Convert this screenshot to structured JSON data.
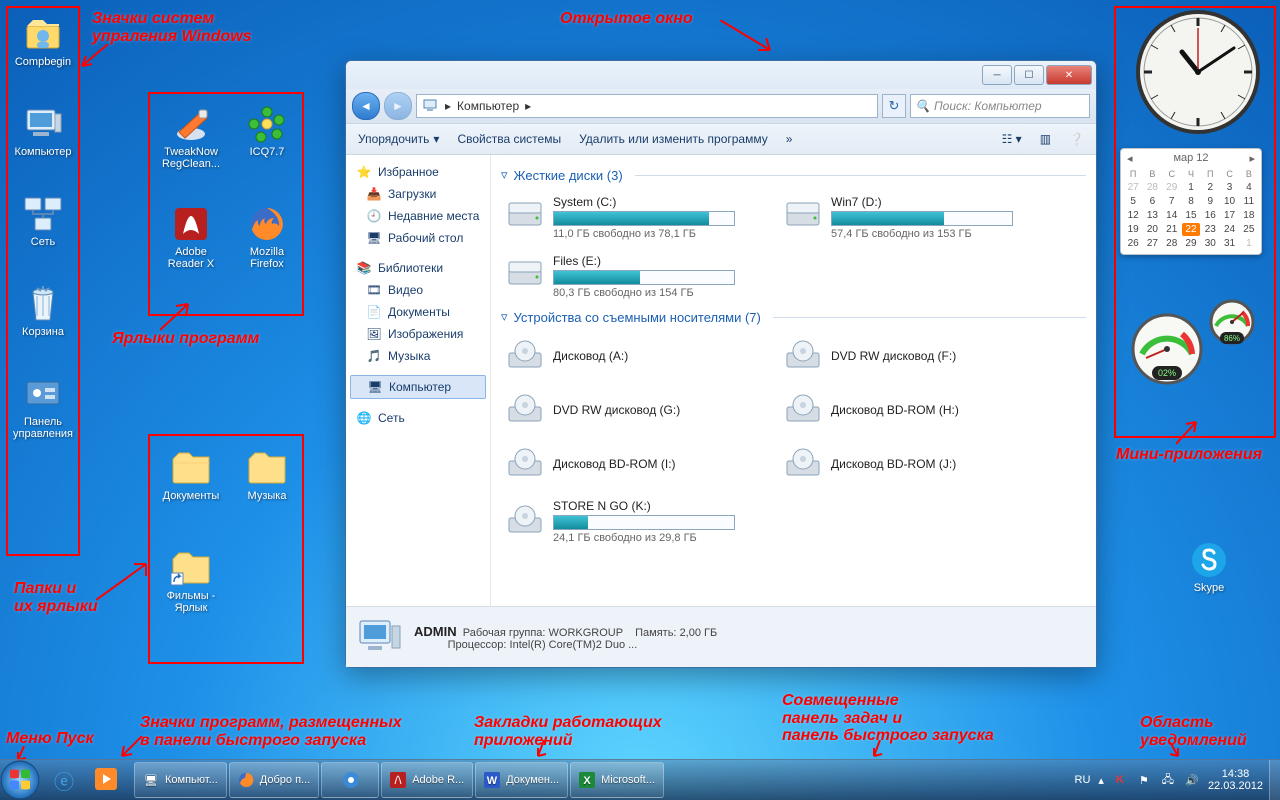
{
  "annotations": {
    "sys_icons": "Значки систем\nупраления Windows",
    "open_window": "Открытое окно",
    "shortcuts": "Ярлыки программ",
    "folders": "Папки и\nих ярлыки",
    "gadgets": "Мини-приложения",
    "start": "Меню Пуск",
    "quicklaunch": "Значки программ, размещенных\nв панели быстрого запуска",
    "tabs": "Закладки работающих\nприложений",
    "task_combo": "Совмещенные\nпанель задач и\nпанель быстрого запуска",
    "notif": "Область\nуведомлений"
  },
  "desktop_icons": {
    "left": [
      {
        "name": "Compbegin"
      },
      {
        "name": "Компьютер"
      },
      {
        "name": "Сеть"
      },
      {
        "name": "Корзина"
      },
      {
        "name": "Панель управления"
      }
    ],
    "apps": [
      {
        "name": "TweakNow RegClean..."
      },
      {
        "name": "ICQ7.7"
      },
      {
        "name": "Adobe Reader X"
      },
      {
        "name": "Mozilla Firefox"
      }
    ],
    "folders": [
      {
        "name": "Документы"
      },
      {
        "name": "Музыка"
      },
      {
        "name": "Фильмы - Ярлык"
      }
    ],
    "skype": "Skype"
  },
  "explorer": {
    "breadcrumb": "Компьютер",
    "search_placeholder": "Поиск: Компьютер",
    "toolbar": {
      "organize": "Упорядочить",
      "sysprops": "Свойства системы",
      "uninstall": "Удалить или изменить программу",
      "more": "»"
    },
    "nav": {
      "fav_head": "Избранное",
      "fav": [
        "Загрузки",
        "Недавние места",
        "Рабочий стол"
      ],
      "lib_head": "Библиотеки",
      "lib": [
        "Видео",
        "Документы",
        "Изображения",
        "Музыка"
      ],
      "computer": "Компьютер",
      "network": "Сеть"
    },
    "hdd_group": "Жесткие диски (3)",
    "hdd": [
      {
        "name": "System (C:)",
        "free": "11,0 ГБ свободно из 78,1 ГБ",
        "pct": 86
      },
      {
        "name": "Win7 (D:)",
        "free": "57,4 ГБ свободно из 153 ГБ",
        "pct": 62
      },
      {
        "name": "Files (E:)",
        "free": "80,3 ГБ свободно из 154 ГБ",
        "pct": 48
      }
    ],
    "rem_group": "Устройства со съемными носителями (7)",
    "rem": [
      {
        "name": "Дисковод (A:)"
      },
      {
        "name": "DVD RW дисковод (F:)"
      },
      {
        "name": "DVD RW дисковод (G:)"
      },
      {
        "name": "Дисковод BD-ROM (H:)"
      },
      {
        "name": "Дисковод BD-ROM (I:)"
      },
      {
        "name": "Дисковод BD-ROM (J:)"
      },
      {
        "name": "STORE N GO (K:)",
        "free": "24,1 ГБ свободно из 29,8 ГБ",
        "pct": 19
      }
    ],
    "details": {
      "user": "ADMIN",
      "workgroup_l": "Рабочая группа:",
      "workgroup": "WORKGROUP",
      "mem_l": "Память:",
      "mem": "2,00 ГБ",
      "cpu_l": "Процессор:",
      "cpu": "Intel(R) Core(TM)2 Duo ..."
    }
  },
  "gadgets": {
    "cal_month": "мар 12",
    "cal_dow": [
      "П",
      "В",
      "С",
      "Ч",
      "П",
      "С",
      "В"
    ],
    "cal_days": [
      27,
      28,
      29,
      1,
      2,
      3,
      4,
      5,
      6,
      7,
      8,
      9,
      10,
      11,
      12,
      13,
      14,
      15,
      16,
      17,
      18,
      19,
      20,
      21,
      22,
      23,
      24,
      25,
      26,
      27,
      28,
      29,
      30,
      31,
      1
    ],
    "cal_today": 22,
    "cpu_pct": "02%",
    "ram_pct": "86%"
  },
  "taskbar": {
    "running": [
      {
        "label": "Компьют..."
      },
      {
        "label": "Добро п..."
      },
      {
        "label": ""
      },
      {
        "label": "Adobe R..."
      },
      {
        "label": "Докумен..."
      },
      {
        "label": "Microsoft..."
      }
    ],
    "lang": "RU",
    "time": "14:38",
    "date": "22.03.2012"
  }
}
